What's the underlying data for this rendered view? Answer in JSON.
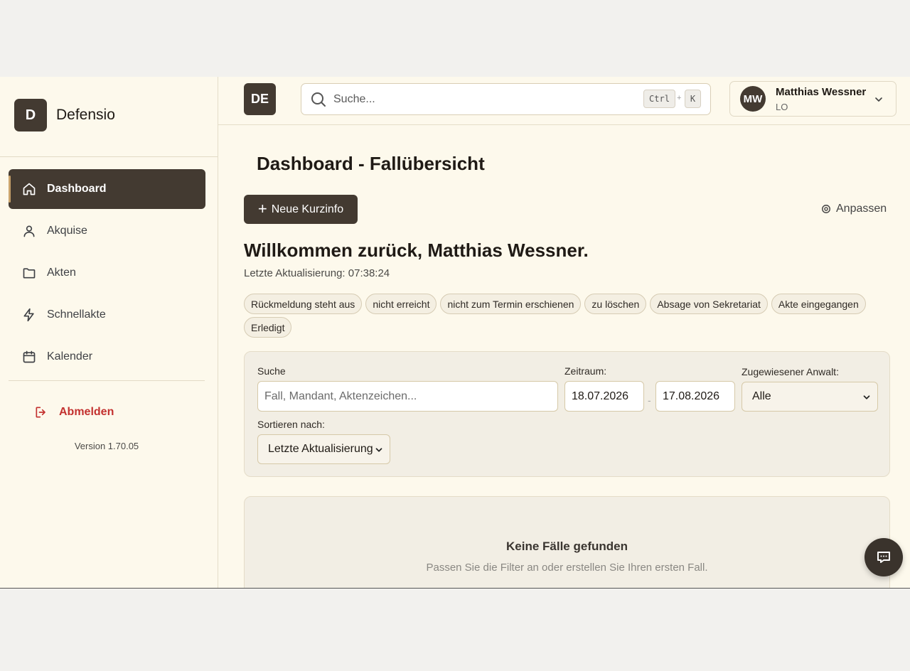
{
  "brand": {
    "logo_letter": "D",
    "name": "Defensio"
  },
  "sidebar": {
    "items": [
      {
        "label": "Dashboard",
        "icon": "home-icon",
        "active": true
      },
      {
        "label": "Akquise",
        "icon": "user-icon",
        "active": false
      },
      {
        "label": "Akten",
        "icon": "folder-icon",
        "active": false
      },
      {
        "label": "Schnellakte",
        "icon": "lightning-icon",
        "active": false
      },
      {
        "label": "Kalender",
        "icon": "calendar-icon",
        "active": false
      }
    ],
    "logout_label": "Abmelden",
    "version": "Version 1.70.05"
  },
  "header": {
    "badge": "DE",
    "search_placeholder": "Suche...",
    "shortcut_ctrl": "Ctrl",
    "shortcut_plus": "+",
    "shortcut_key": "K",
    "user": {
      "initials": "MW",
      "name": "Matthias Wessner",
      "role": "LO"
    }
  },
  "main": {
    "title": "Dashboard - Fallübersicht",
    "new_button": "Neue Kurzinfo",
    "customize_label": "Anpassen",
    "welcome": "Willkommen zurück, Matthias Wessner.",
    "last_update": "Letzte Aktualisierung: 07:38:24",
    "chips": [
      "Rückmeldung steht aus",
      "nicht erreicht",
      "nicht zum Termin erschienen",
      "zu löschen",
      "Absage von Sekretariat",
      "Akte eingegangen",
      "Erledigt"
    ]
  },
  "filters": {
    "search_label": "Suche",
    "search_placeholder": "Fall, Mandant, Aktenzeichen...",
    "period_label": "Zeitraum:",
    "date_from": "18.07.2026",
    "date_to": "17.08.2026",
    "date_separator": "-",
    "lawyer_label": "Zugewiesener Anwalt:",
    "lawyer_value": "Alle",
    "sort_label": "Sortieren nach:",
    "sort_value": "Letzte Aktualisierung"
  },
  "empty": {
    "title": "Keine Fälle gefunden",
    "subtitle": "Passen Sie die Filter an oder erstellen Sie Ihren ersten Fall."
  },
  "colors": {
    "primary": "#433a31",
    "background": "#fdf9ec",
    "danger": "#c3312f",
    "accent": "#c9a36b"
  }
}
